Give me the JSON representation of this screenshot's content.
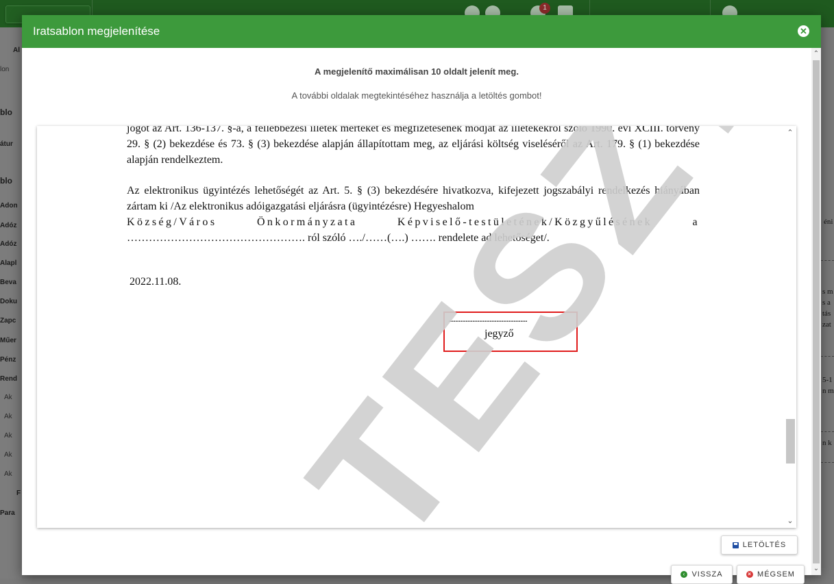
{
  "modal": {
    "title": "Iratsablon megjelenítése",
    "close_icon": "close-circle-icon",
    "notice_primary": "A megjelenítő maximálisan 10 oldalt jelenít meg.",
    "notice_secondary": "A további oldalak megtekintéséhez használja a letöltés gombot!"
  },
  "document": {
    "paragraph_1": "jogot az Art. 136-137. §-a, a fellebbezési illeték mértékét és megfizetésének módját az illetékekről szóló 1990. évi XCIII. törvény 29. § (2) bekezdése és 73. § (3) bekezdése alapján állapítottam meg, az eljárási költség viseléséről az Art. 179. § (1) bekezdése alapján rendelkeztem.",
    "paragraph_2_line_1": "Az elektronikus ügyintézés lehetőségét az Art. 5. § (3) bekezdésére hivatkozva, kifejezett jogszabályi rendelkezés hiányában zártam ki /Az elektronikus adóigazgatási eljárásra (ügyintézésre) Hegyeshalom",
    "paragraph_2_line_2": "Község/Város Önkormányzata Képviselő-testületének/Közgyűlésének a",
    "paragraph_2_line_3": "…………………………………………. ról szóló …./……(….) ……. rendelete ad lehetőséget/.",
    "date": "2022.11.08.",
    "signature_line": "..............................................",
    "signature_title": "jegyző",
    "watermark": "TESZT"
  },
  "buttons": {
    "download": "LETÖLTÉS",
    "back": "VISSZA",
    "cancel": "MÉGSEM"
  },
  "background": {
    "notification_count": "1",
    "sidebar_labels": [
      "Al",
      "lon",
      "blo",
      "átur",
      "blo",
      "Adon",
      "Adóz",
      "Adóz",
      "Alapl",
      "Beva",
      "Doku",
      "Zapc",
      "Műer",
      "Pénz",
      "Rend",
      "Ak",
      "Ak",
      "Ak",
      "Ak",
      "Ak",
      "F",
      "Para"
    ],
    "right_labels": [
      "éni",
      "s m",
      "s a",
      "tás",
      "zat",
      "5-1",
      "n m",
      "n k"
    ]
  },
  "colors": {
    "header_green": "#3d9a3c",
    "highlight_red": "#e01b1b",
    "watermark_gray": "#cfcfcf"
  }
}
